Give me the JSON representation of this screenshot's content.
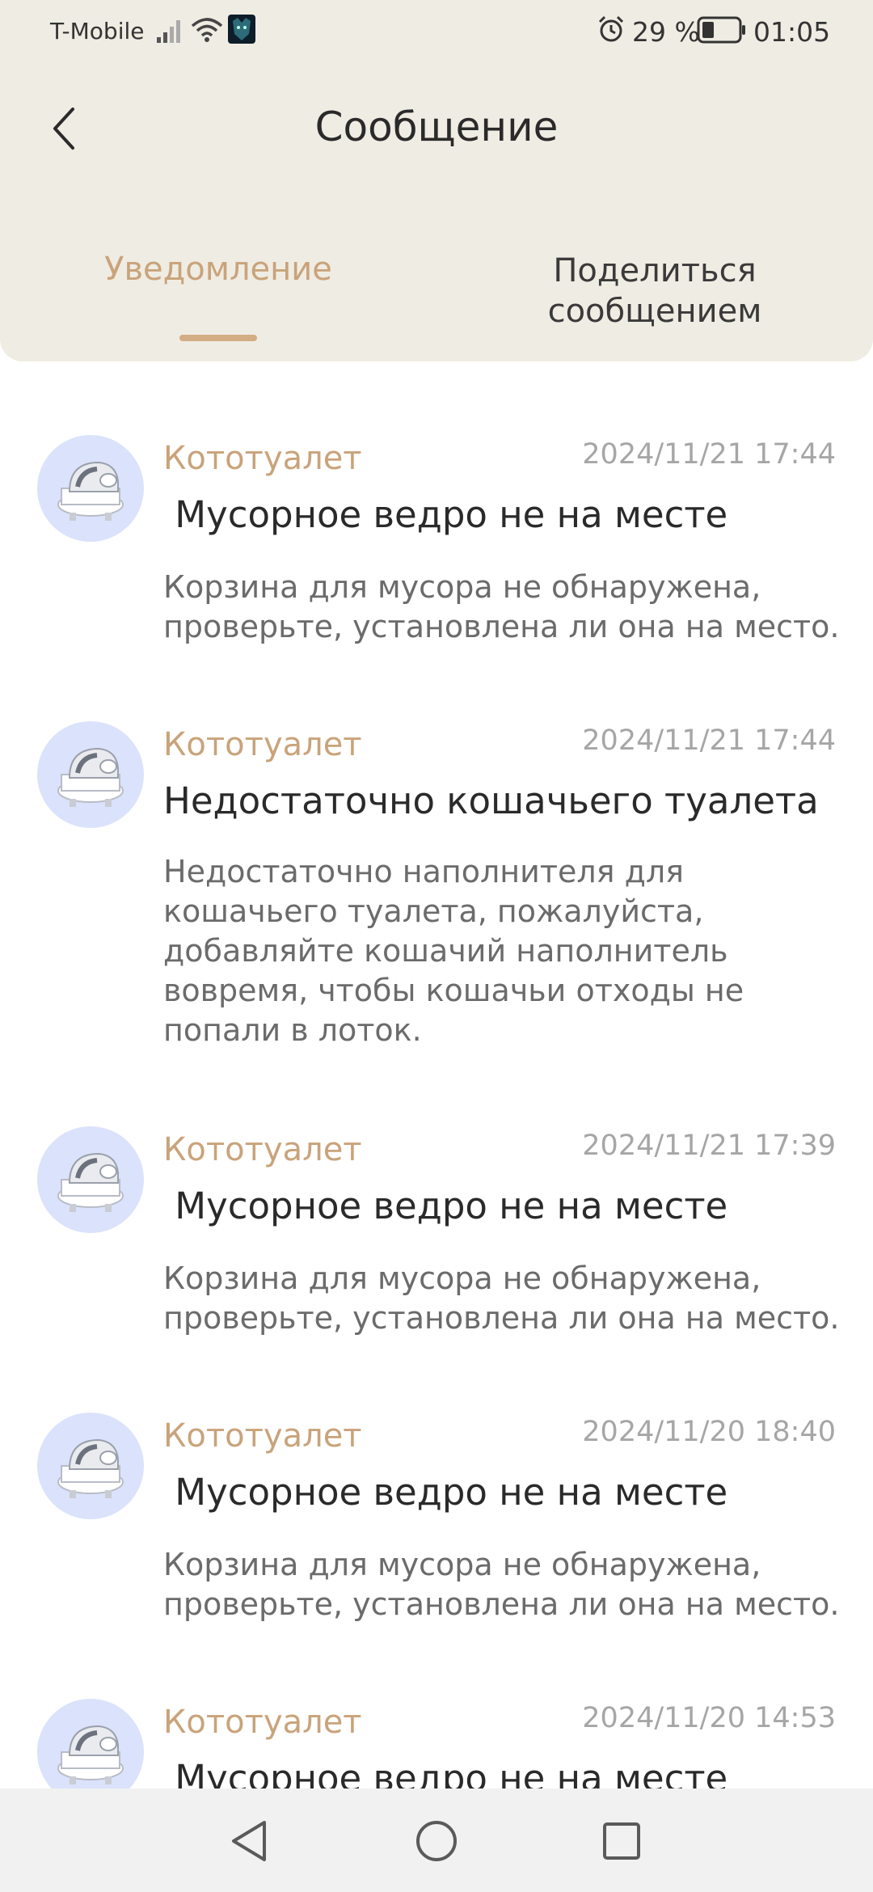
{
  "status_bar": {
    "carrier": "T-Mobile",
    "battery_percent": "29 %",
    "time": "01:05"
  },
  "header": {
    "title": "Сообщение"
  },
  "tabs": [
    {
      "label": "Уведомление",
      "active": true
    },
    {
      "label": "Поделиться\nсообщением",
      "active": false
    }
  ],
  "messages": [
    {
      "device": "Кототуалет",
      "timestamp": "2024/11/21 17:44",
      "title": " Мусорное ведро не на месте",
      "body": "Корзина для мусора не обнаружена, проверьте, установлена ли она на место."
    },
    {
      "device": "Кототуалет",
      "timestamp": "2024/11/21 17:44",
      "title": "Недостаточно кошачьего туалета",
      "body": "Недостаточно наполнителя для кошачьего туалета, пожалуйста, добавляйте кошачий наполнитель вовремя, чтобы кошачьи отходы не попали в лоток."
    },
    {
      "device": "Кототуалет",
      "timestamp": "2024/11/21 17:39",
      "title": " Мусорное ведро не на месте",
      "body": "Корзина для мусора не обнаружена, проверьте, установлена ли она на место."
    },
    {
      "device": "Кототуалет",
      "timestamp": "2024/11/20 18:40",
      "title": " Мусорное ведро не на месте",
      "body": "Корзина для мусора не обнаружена, проверьте, установлена ли она на место."
    },
    {
      "device": "Кототуалет",
      "timestamp": "2024/11/20 14:53",
      "title": " Мусорное ведро не на месте",
      "body": ""
    }
  ],
  "colors": {
    "accent": "#c9a37a",
    "header_bg": "#efece3",
    "avatar_bg": "#dbe2fb"
  }
}
